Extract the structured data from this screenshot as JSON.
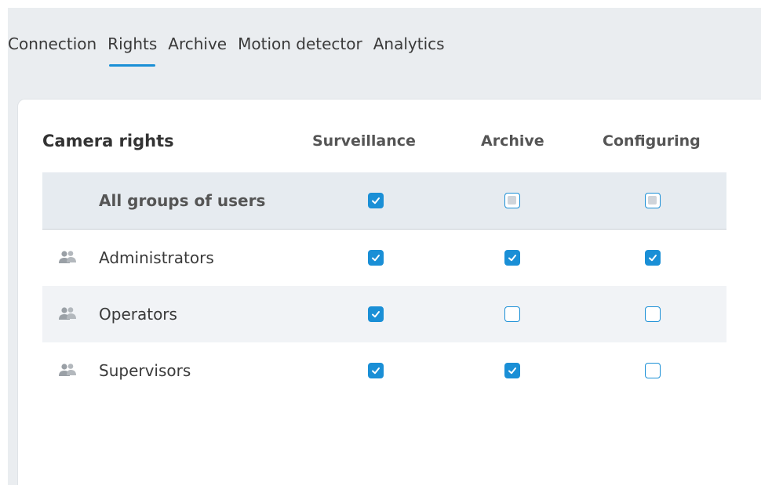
{
  "tabs": [
    {
      "label": "Connection",
      "active": false
    },
    {
      "label": "Rights",
      "active": true
    },
    {
      "label": "Archive",
      "active": false
    },
    {
      "label": "Motion detector",
      "active": false
    },
    {
      "label": "Analytics",
      "active": false
    }
  ],
  "table": {
    "title": "Camera rights",
    "columns": [
      "Surveillance",
      "Archive",
      "Configuring"
    ],
    "rows": [
      {
        "label": "All groups of users",
        "icon": null,
        "states": [
          "checked",
          "partial",
          "partial"
        ]
      },
      {
        "label": "Administrators",
        "icon": "user-group-icon",
        "states": [
          "checked",
          "checked",
          "checked"
        ]
      },
      {
        "label": "Operators",
        "icon": "user-group-icon",
        "states": [
          "checked",
          "unchecked",
          "unchecked"
        ]
      },
      {
        "label": "Supervisors",
        "icon": "user-group-icon",
        "states": [
          "checked",
          "checked",
          "unchecked"
        ]
      }
    ]
  },
  "colors": {
    "accent": "#1a8fd6",
    "tab_bg": "#eaedf0",
    "all_row_bg": "#e6ebf0",
    "shade_row_bg": "#f1f3f6"
  }
}
